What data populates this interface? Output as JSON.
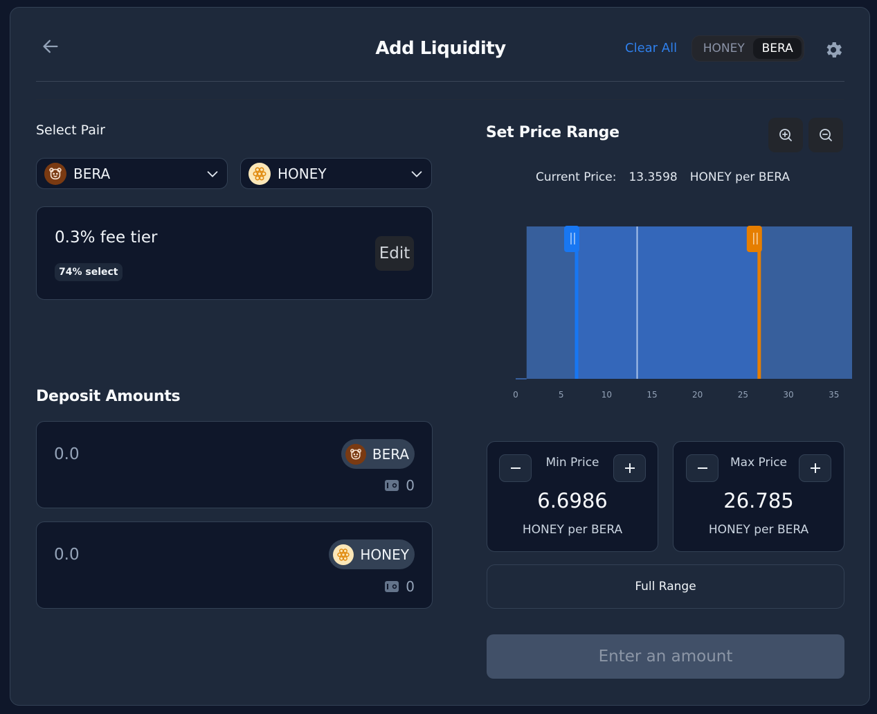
{
  "header": {
    "title": "Add Liquidity",
    "clear_all_label": "Clear All",
    "denomination_toggle": {
      "options": [
        "HONEY",
        "BERA"
      ],
      "selected": "BERA"
    }
  },
  "select_pair": {
    "label": "Select Pair",
    "token_a": {
      "symbol": "BERA",
      "icon": "bear-icon"
    },
    "token_b": {
      "symbol": "HONEY",
      "icon": "honeycomb-icon"
    }
  },
  "fee_tier": {
    "label": "0.3% fee tier",
    "selection_badge": "74% select",
    "edit_label": "Edit"
  },
  "deposit": {
    "label": "Deposit Amounts",
    "inputs": [
      {
        "value": "0.0",
        "token": "BERA",
        "balance": "0"
      },
      {
        "value": "0.0",
        "token": "HONEY",
        "balance": "0"
      }
    ]
  },
  "price_range": {
    "label": "Set Price Range",
    "current_price_label": "Current Price:",
    "current_price_value": "13.3598",
    "current_price_unit": "HONEY per BERA",
    "min": {
      "label": "Min Price",
      "value": "6.6986",
      "unit": "HONEY per BERA"
    },
    "max": {
      "label": "Max Price",
      "value": "26.785",
      "unit": "HONEY per BERA"
    },
    "full_range_label": "Full Range"
  },
  "submit": {
    "label": "Enter an amount",
    "enabled": false
  },
  "colors": {
    "accent_blue": "#2f80ed",
    "min_handle": "#1877f2",
    "max_handle": "#e67e00",
    "liquidity_fill": "#375f9c",
    "selected_fill": "#3468c0"
  },
  "chart_data": {
    "type": "area",
    "xlabel": "",
    "ylabel": "",
    "x_ticks": [
      0,
      5,
      10,
      15,
      20,
      25,
      30,
      35
    ],
    "xlim": [
      0,
      37
    ],
    "liquidity": {
      "x": [
        0,
        1.2,
        1.2,
        37
      ],
      "y": [
        0,
        0,
        1,
        1
      ]
    },
    "current_price": 13.3598,
    "range_min": 6.6986,
    "range_max": 26.785,
    "grid": false,
    "legend": "none"
  }
}
